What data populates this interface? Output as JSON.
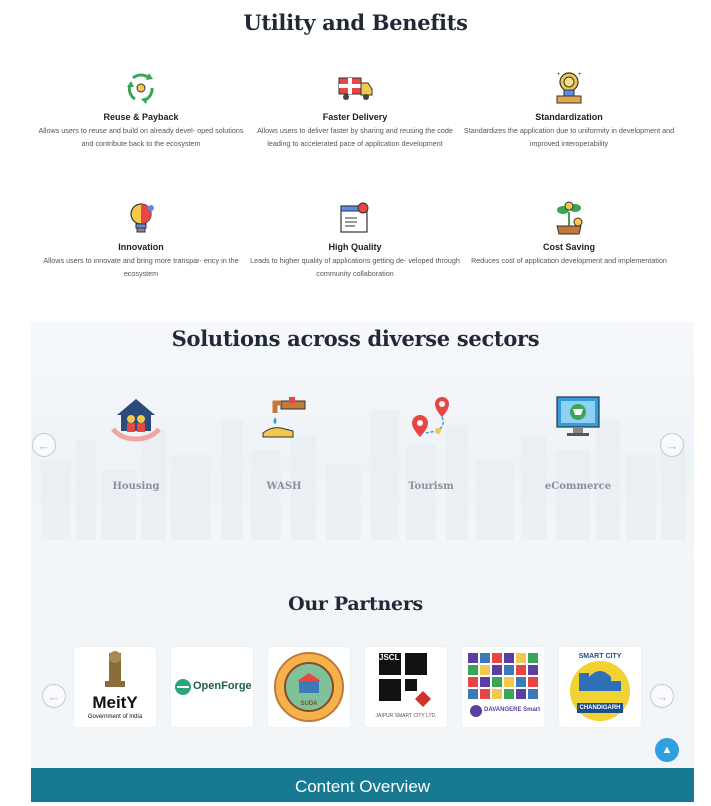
{
  "benefits": {
    "title": "Utility and Benefits",
    "items": [
      {
        "name": "Reuse & Payback",
        "desc": "Allows users to reuse and build on already devel- oped solutions and contribute back to the ecosystem",
        "icon": "recycle-icon"
      },
      {
        "name": "Faster Delivery",
        "desc": "Allows users to deliver faster by sharing and reusing the code leading to accelerated pace of application development",
        "icon": "delivery-truck-icon"
      },
      {
        "name": "Standardization",
        "desc": "Standardizes the application due to uniformity in development and improved interoperability",
        "icon": "award-medal-icon"
      },
      {
        "name": "Innovation",
        "desc": "Allows users to innovate and bring more transpar- ency in the ecosystem",
        "icon": "idea-bulb-icon"
      },
      {
        "name": "High Quality",
        "desc": "Leads to higher quality of applications getting de- veloped through community collaboration",
        "icon": "quality-certificate-icon"
      },
      {
        "name": "Cost Saving",
        "desc": "Reduces cost of application development and implementation",
        "icon": "money-plant-icon"
      }
    ]
  },
  "sectors": {
    "title": "Solutions across diverse sectors",
    "items": [
      {
        "name": "Housing",
        "icon": "housing-icon"
      },
      {
        "name": "WASH",
        "icon": "water-tap-icon"
      },
      {
        "name": "Tourism",
        "icon": "map-pin-route-icon"
      },
      {
        "name": "eCommerce",
        "icon": "ecommerce-monitor-icon"
      }
    ],
    "prev_icon": "←",
    "next_icon": "→"
  },
  "partners": {
    "title": "Our Partners",
    "logos": [
      {
        "name": "MeitY",
        "caption": "Government of India"
      },
      {
        "name": "OpenForge",
        "caption": ""
      },
      {
        "name": "SUDA",
        "caption": ""
      },
      {
        "name": "JSCL",
        "caption": "JAIPUR SMART CITY LTD."
      },
      {
        "name": "DAVANGERE Smart",
        "caption": ""
      },
      {
        "name": "SMART CITY",
        "caption": "CHANDIGARH"
      }
    ],
    "prev_icon": "←",
    "next_icon": "→"
  },
  "scroll_top_icon": "▲",
  "footer_bar": {
    "label": "Content Overview"
  },
  "colors": {
    "accent": "#177a92",
    "scroll_button": "#2e9fe0",
    "heading": "#1f2a36"
  }
}
